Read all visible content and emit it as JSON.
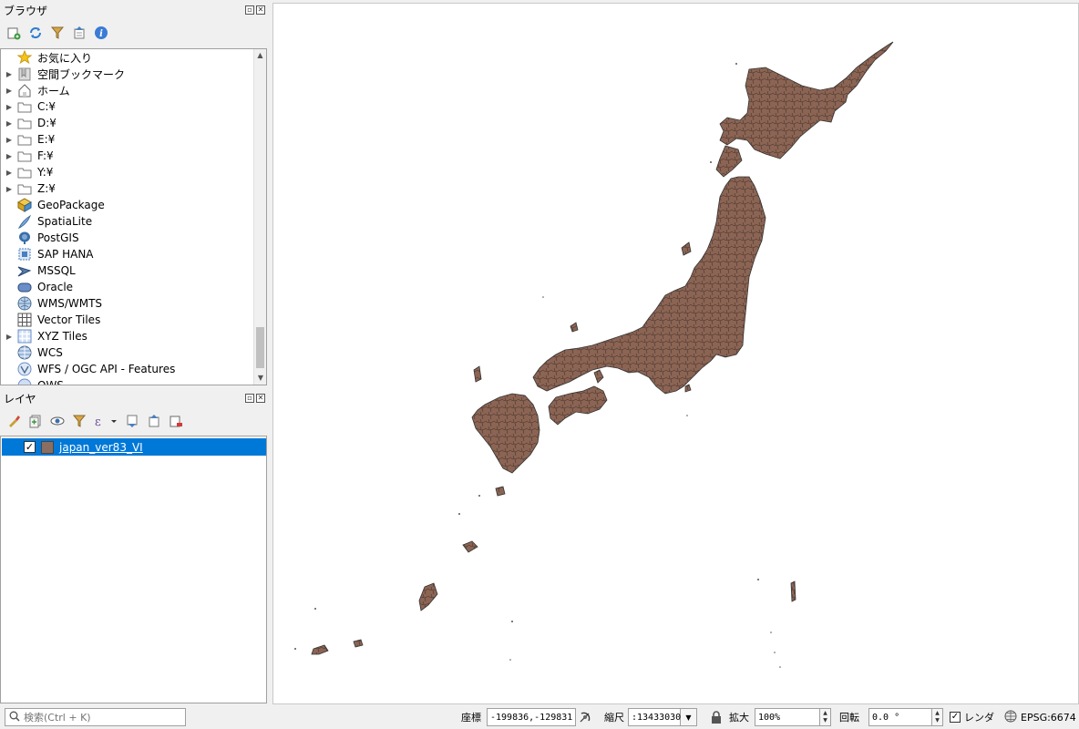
{
  "browser_panel": {
    "title": "ブラウザ",
    "items": [
      {
        "label": "お気に入り",
        "icon": "star-icon",
        "expandable": false
      },
      {
        "label": "空間ブックマーク",
        "icon": "bookmark-icon",
        "expandable": true
      },
      {
        "label": "ホーム",
        "icon": "home-icon",
        "expandable": true
      },
      {
        "label": "C:¥",
        "icon": "folder-icon",
        "expandable": true
      },
      {
        "label": "D:¥",
        "icon": "folder-icon",
        "expandable": true
      },
      {
        "label": "E:¥",
        "icon": "folder-icon",
        "expandable": true
      },
      {
        "label": "F:¥",
        "icon": "folder-icon",
        "expandable": true
      },
      {
        "label": "Y:¥",
        "icon": "folder-icon",
        "expandable": true
      },
      {
        "label": "Z:¥",
        "icon": "folder-icon",
        "expandable": true
      },
      {
        "label": "GeoPackage",
        "icon": "geopackage-icon",
        "expandable": false
      },
      {
        "label": "SpatiaLite",
        "icon": "spatialite-icon",
        "expandable": false
      },
      {
        "label": "PostGIS",
        "icon": "postgis-icon",
        "expandable": false
      },
      {
        "label": "SAP HANA",
        "icon": "sap-hana-icon",
        "expandable": false
      },
      {
        "label": "MSSQL",
        "icon": "mssql-icon",
        "expandable": false
      },
      {
        "label": "Oracle",
        "icon": "oracle-icon",
        "expandable": false
      },
      {
        "label": "WMS/WMTS",
        "icon": "wms-icon",
        "expandable": false
      },
      {
        "label": "Vector Tiles",
        "icon": "vector-tiles-icon",
        "expandable": false
      },
      {
        "label": "XYZ Tiles",
        "icon": "xyz-tiles-icon",
        "expandable": true
      },
      {
        "label": "WCS",
        "icon": "wcs-icon",
        "expandable": false
      },
      {
        "label": "WFS / OGC API - Features",
        "icon": "wfs-icon",
        "expandable": false
      },
      {
        "label": "OWS",
        "icon": "ows-icon",
        "expandable": false
      }
    ]
  },
  "layers_panel": {
    "title": "レイヤ",
    "layers": [
      {
        "name": "japan_ver83_VI",
        "checked": true,
        "fill_color": "#8a6e62",
        "selected": true
      }
    ]
  },
  "map": {
    "fill_color": "#8b6454",
    "stroke_color": "#333333",
    "background": "#ffffff"
  },
  "statusbar": {
    "search_placeholder": "検索(Ctrl + K)",
    "coordinate_label": "座標",
    "coordinate_value": "-199836,-129831",
    "scale_label": "縮尺",
    "scale_value": ":13433030",
    "magnifier_label": "拡大",
    "magnifier_value": "100%",
    "rotation_label": "回転",
    "rotation_value": "0.0 °",
    "render_label": "レンダ",
    "render_checked": true,
    "crs": "EPSG:6674"
  }
}
